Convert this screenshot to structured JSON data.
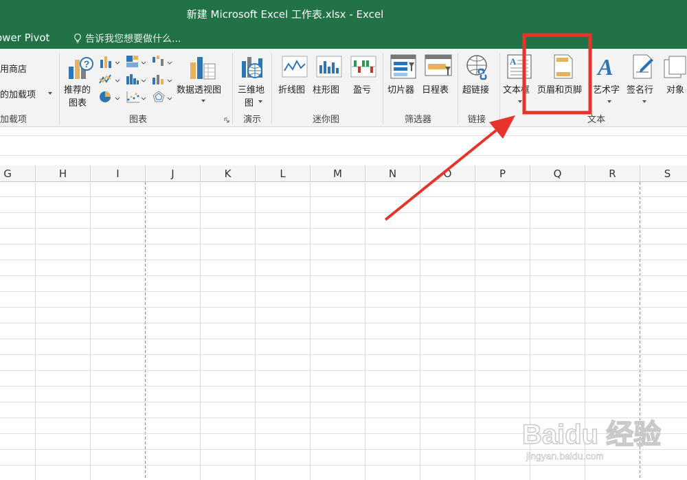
{
  "window": {
    "title": "新建 Microsoft Excel 工作表.xlsx - Excel"
  },
  "tabs": {
    "power_pivot": "ower Pivot",
    "tell_me": "告诉我您想要做什么..."
  },
  "ribbon": {
    "addins": {
      "store": "用商店",
      "my_addins": "的加载项",
      "group": "加载项"
    },
    "charts": {
      "recommended_line1": "推荐的",
      "recommended_line2": "图表",
      "pivot_chart": "数据透视图",
      "group": "图表"
    },
    "tours": {
      "map_line1": "三维地",
      "map_line2": "图",
      "group": "演示"
    },
    "sparklines": {
      "line": "折线图",
      "column": "柱形图",
      "winloss": "盈亏",
      "group": "迷你图"
    },
    "filters": {
      "slicer": "切片器",
      "timeline": "日程表",
      "group": "筛选器"
    },
    "links": {
      "hyperlink": "超链接",
      "group": "链接"
    },
    "text": {
      "textbox": "文本框",
      "header_footer": "页眉和页脚",
      "wordart": "艺术字",
      "signature": "签名行",
      "object": "对象",
      "group": "文本"
    }
  },
  "columns": [
    "G",
    "H",
    "I",
    "J",
    "K",
    "L",
    "M",
    "N",
    "O",
    "P",
    "Q",
    "R",
    "S"
  ],
  "colors": {
    "excel_green": "#217346",
    "highlight_red": "#e8332b"
  },
  "watermark": {
    "brand": "Baidu 经验",
    "url": "jingyan.baidu.com"
  }
}
